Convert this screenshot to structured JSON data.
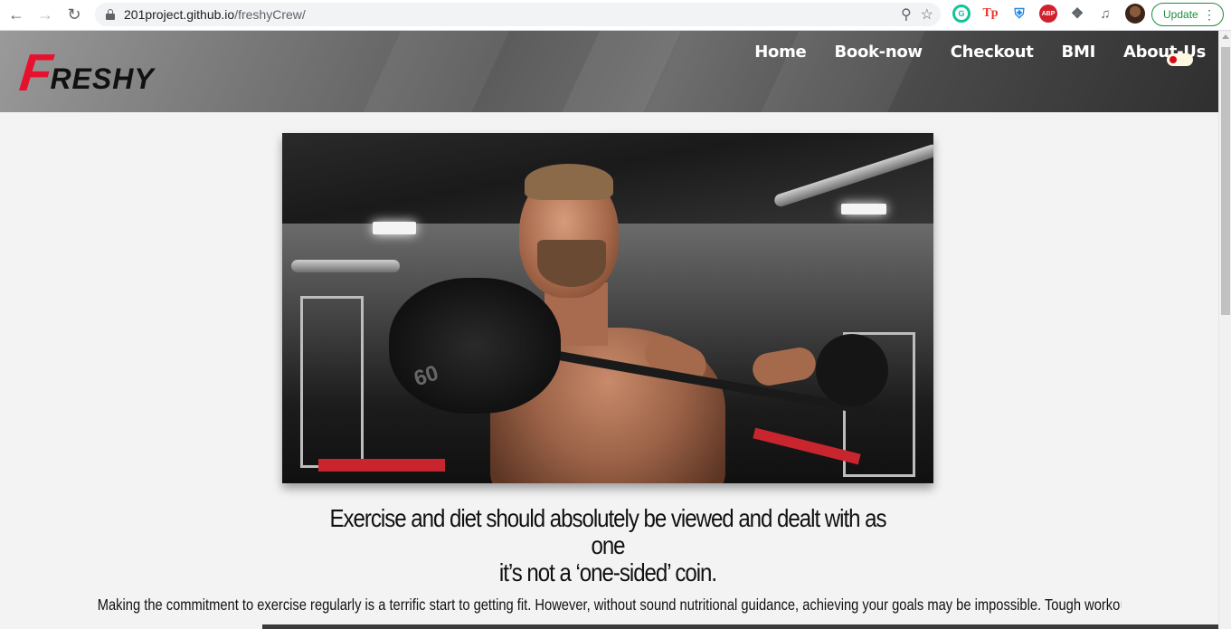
{
  "browser": {
    "url_host": "201project.github.io",
    "url_path": "/freshyCrew/",
    "update_label": "Update",
    "extensions": [
      "grammarly-icon",
      "tp-icon",
      "shield-icon",
      "abp-icon",
      "puzzle-icon",
      "media-icon"
    ],
    "ext_labels": {
      "grammarly": "G",
      "tp": "Tp",
      "abp": "ABP"
    }
  },
  "site": {
    "logo_initial": "F",
    "logo_rest": "RESHY",
    "nav": [
      "Home",
      "Book-now",
      "Checkout",
      "BMI",
      "About-Us"
    ],
    "theme_toggle": "on",
    "colors": {
      "accent": "#e8112d",
      "toggle_knob": "#d30a1c"
    }
  },
  "hero": {
    "plate_number": "60"
  },
  "content": {
    "headline_line1": "Exercise and diet should absolutely be viewed and dealt with as one",
    "headline_line2": "it’s not a ‘one-sided’ coin.",
    "paragraph": "Making the commitment to exercise regularly is a terrific start to getting fit. However, without sound nutritional guidance, achieving your goals may be impossible. Tough workouts demand the right kind of fuel —"
  }
}
